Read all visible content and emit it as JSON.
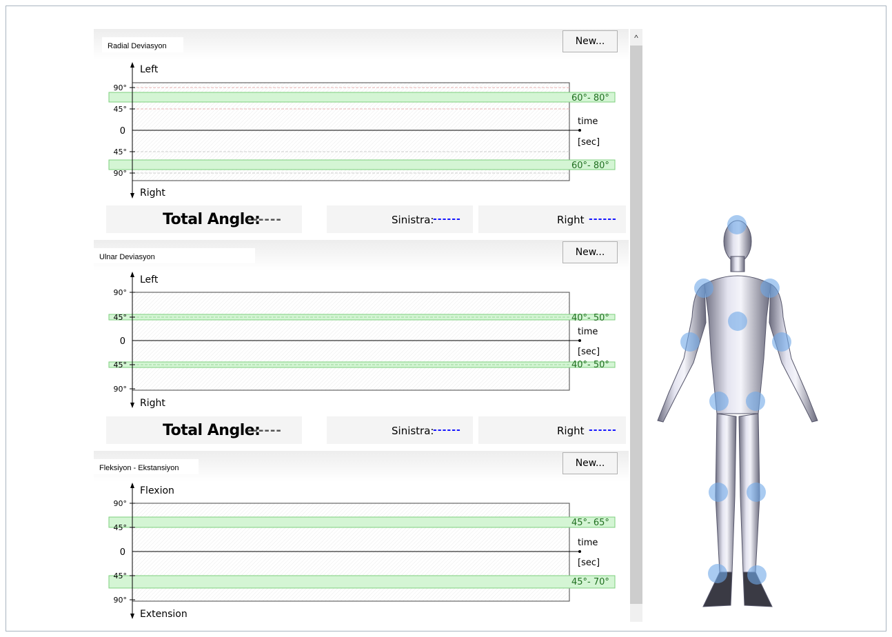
{
  "new_button_label": "New...",
  "panels": [
    {
      "title": "Radial Deviasyon",
      "up_label": "Left",
      "down_label": "Right",
      "axis_labels": {
        "top90": "90°",
        "top45": "45°",
        "zero": "0",
        "bot45": "45°",
        "bot90": "90°"
      },
      "time_label": "time",
      "unit_label": "[sec]",
      "range_top": "60°- 80°",
      "range_bottom": "60°- 80°",
      "total_label": "Total Angle:",
      "total_value": "------",
      "left_side_label": "Sinistra:",
      "left_side_value": "------",
      "right_side_label": "Right",
      "right_side_value": "------"
    },
    {
      "title": "Ulnar Deviasyon",
      "up_label": "Left",
      "down_label": "Right",
      "axis_labels": {
        "top90": "90°",
        "top45": "45°",
        "zero": "0",
        "bot45": "45°",
        "bot90": "90°"
      },
      "time_label": "time",
      "unit_label": "[sec]",
      "range_top": "40°- 50°",
      "range_bottom": "40°- 50°",
      "total_label": "Total Angle:",
      "total_value": "------",
      "left_side_label": "Sinistra:",
      "left_side_value": "------",
      "right_side_label": "Right",
      "right_side_value": "------"
    },
    {
      "title": "Fleksiyon - Ekstansiyon",
      "up_label": "Flexion",
      "down_label": "Extension",
      "axis_labels": {
        "top90": "90°",
        "top45": "45°",
        "zero": "0",
        "bot45": "45°",
        "bot90": "90°"
      },
      "time_label": "time",
      "unit_label": "[sec]",
      "range_top": "45°- 65°",
      "range_bottom": "45°- 70°"
    }
  ],
  "colors": {
    "band_fill": "#d4f5d4",
    "band_stroke": "#7ccf7c",
    "range_text": "#1f6f1f",
    "joint_marker": "#6fa8e8",
    "dash_blue": "#1515ff"
  }
}
